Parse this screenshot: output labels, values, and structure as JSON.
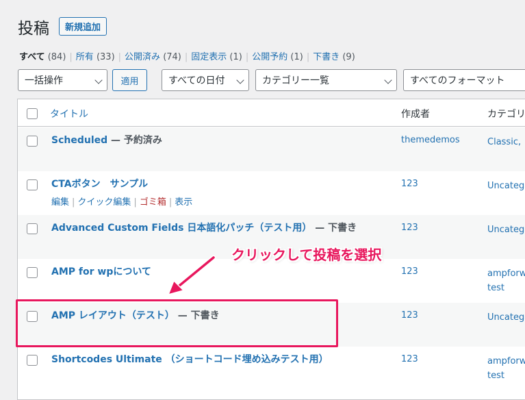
{
  "header": {
    "title": "投稿",
    "add_new_label": "新規追加"
  },
  "filters": [
    {
      "label": "すべて",
      "count": "(84)",
      "current": true
    },
    {
      "label": "所有",
      "count": "(33)"
    },
    {
      "label": "公開済み",
      "count": "(74)"
    },
    {
      "label": "固定表示",
      "count": "(1)"
    },
    {
      "label": "公開予約",
      "count": "(1)"
    },
    {
      "label": "下書き",
      "count": "(9)"
    }
  ],
  "toolbar": {
    "bulk_action": "一括操作",
    "apply_label": "適用",
    "date_filter": "すべての日付",
    "category_filter": "カテゴリー一覧",
    "format_filter": "すべてのフォーマット"
  },
  "table": {
    "columns": {
      "title": "タイトル",
      "author": "作成者",
      "categories": "カテゴリ"
    },
    "rows": [
      {
        "title": "Scheduled",
        "state": " — 予約済み",
        "author": "themedemos",
        "category": "Classic,",
        "category2": ""
      },
      {
        "title": "CTAボタン　サンプル",
        "state": "",
        "author": "123",
        "category": "Uncateg",
        "category2": "",
        "actions": {
          "edit": "編集",
          "quick_edit": "クイック編集",
          "trash": "ゴミ箱",
          "view": "表示"
        }
      },
      {
        "title": "Advanced Custom Fields 日本語化パッチ（テスト用）",
        "state": " — 下書き",
        "author": "123",
        "category": "Uncateg",
        "category2": ""
      },
      {
        "title": "AMP for wpについて",
        "state": "",
        "author": "123",
        "category": "ampforw",
        "category2": "test"
      },
      {
        "title": "AMP レイアウト（テスト）",
        "state": " — 下書き",
        "author": "123",
        "category": "Uncateg",
        "category2": ""
      },
      {
        "title": "Shortcodes Ultimate （ショートコード埋め込みテスト用）",
        "state": "",
        "author": "123",
        "category": "ampforw",
        "category2": "test"
      }
    ]
  },
  "annotation": {
    "callout": "クリックして投稿を選択",
    "color": "#e8175d"
  }
}
